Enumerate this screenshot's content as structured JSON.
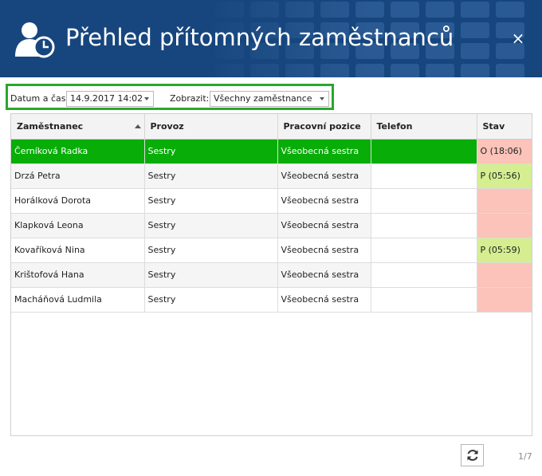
{
  "header": {
    "title": "Přehled přítomných zaměstnanců",
    "close_label": "×",
    "bg_color": "#17467e"
  },
  "filter": {
    "date_label": "Datum a čas:",
    "date_value": "14.9.2017 14:02",
    "show_label": "Zobrazit:",
    "show_value": "Všechny zaměstnance",
    "frame_color": "#29a82b"
  },
  "table": {
    "columns": [
      "Zaměstnanec",
      "Provoz",
      "Pracovní pozice",
      "Telefon",
      "Stav"
    ],
    "rows": [
      {
        "name": "Černíková Radka",
        "provoz": "Sestry",
        "pozice": "Všeobecná sestra",
        "telefon": "",
        "stav": "O (18:06)",
        "stav_color": "#fbc3b9"
      },
      {
        "name": "Drzá Petra",
        "provoz": "Sestry",
        "pozice": "Všeobecná sestra",
        "telefon": "",
        "stav": "P (05:56)",
        "stav_color": "#d4ee90"
      },
      {
        "name": "Horálková Dorota",
        "provoz": "Sestry",
        "pozice": "Všeobecná sestra",
        "telefon": "",
        "stav": "",
        "stav_color": "#fbc3b9"
      },
      {
        "name": "Klapková Leona",
        "provoz": "Sestry",
        "pozice": "Všeobecná sestra",
        "telefon": "",
        "stav": "",
        "stav_color": "#fbc3b9"
      },
      {
        "name": "Kovaříková Nina",
        "provoz": "Sestry",
        "pozice": "Všeobecná sestra",
        "telefon": "",
        "stav": "P (05:59)",
        "stav_color": "#d4ee90"
      },
      {
        "name": "Krištofová Hana",
        "provoz": "Sestry",
        "pozice": "Všeobecná sestra",
        "telefon": "",
        "stav": "",
        "stav_color": "#fbc3b9"
      },
      {
        "name": "Macháňová Ludmila",
        "provoz": "Sestry",
        "pozice": "Všeobecná sestra",
        "telefon": "",
        "stav": "",
        "stav_color": "#fbc3b9"
      }
    ],
    "selected_row_color": "#08ad08"
  },
  "footer": {
    "page_indicator": "1/7"
  }
}
